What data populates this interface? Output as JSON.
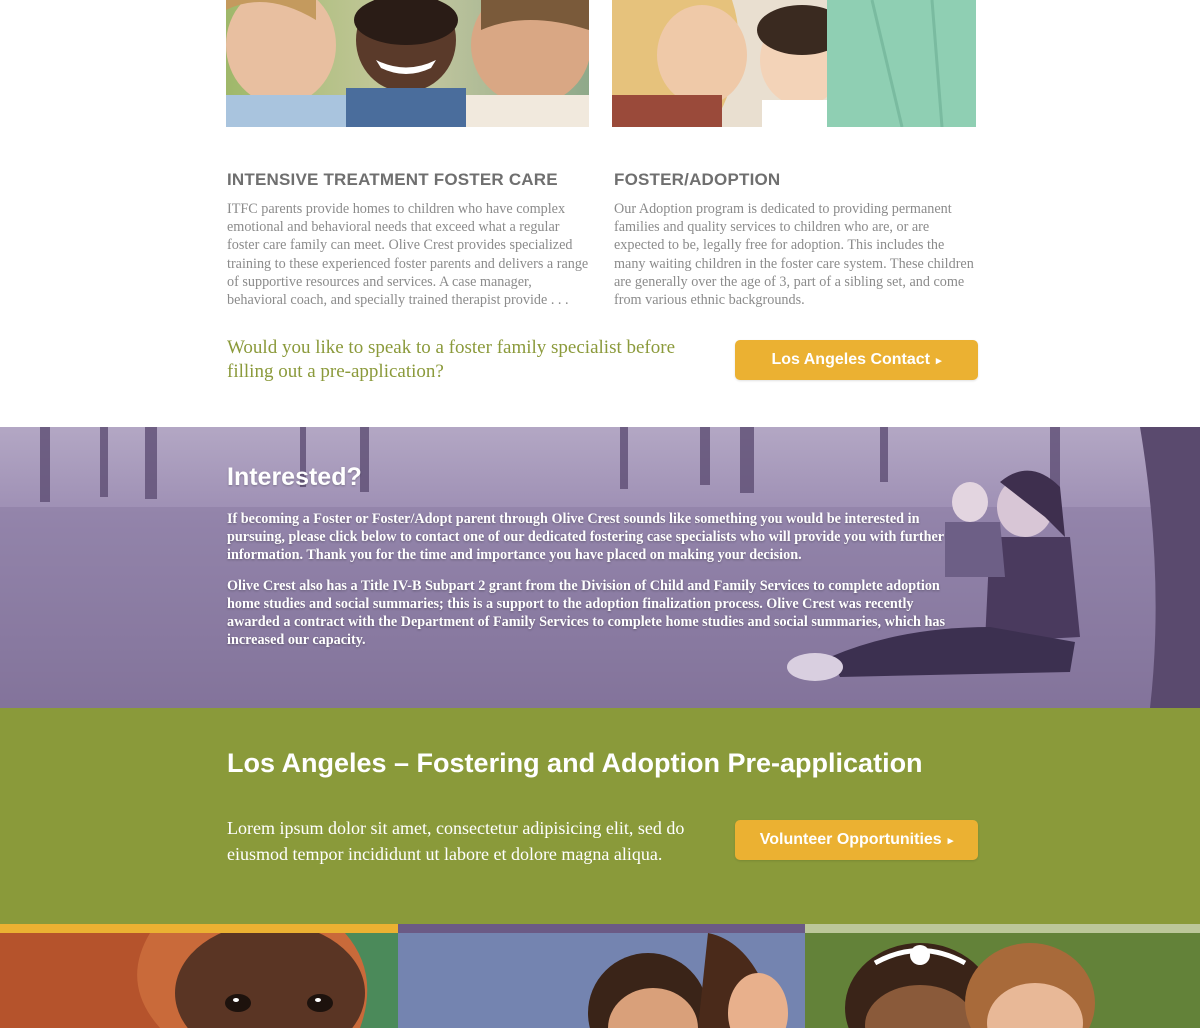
{
  "colors": {
    "accent_yellow": "#ebb132",
    "olive_green": "#8a9a3a",
    "purple": "#8a7aa0",
    "heading_gray": "#6f6f6f",
    "body_gray": "#8b8b8b"
  },
  "programs": [
    {
      "title": "INTENSIVE TREATMENT FOSTER CARE",
      "body": "ITFC parents provide homes to children who have complex emotional and behavioral needs that exceed what a regular foster care family can meet. Olive Crest provides specialized training to these experienced foster parents and delivers a range of supportive resources and services. A case manager, behavioral coach, and specially trained therapist provide . . ."
    },
    {
      "title": "FOSTER/ADOPTION",
      "body": "Our Adoption program is dedicated to providing permanent families and quality services to children who are, or are expected to be, legally free for adoption. This includes the many waiting children in the foster care system. These children are generally over the age of 3, part of a sibling set, and come from various ethnic backgrounds."
    }
  ],
  "cta": {
    "question": "Would you like to speak to a foster family specialist before filling out a pre-application?",
    "button_label": "Los Angeles Contact",
    "button_arrow": "▸"
  },
  "interested": {
    "title": "Interested?",
    "paragraphs": [
      "If becoming a Foster or Foster/Adopt parent through Olive Crest sounds like something you would be interested in pursuing, please click below to contact one of our dedicated fostering case specialists who will provide you with further information. Thank you for the time and importance you have placed on making your decision.",
      "Olive Crest also has a Title IV-B Subpart 2 grant from the Division of Child and Family Services to complete adoption home studies and social summaries; this is a support to the adoption finalization process. Olive Crest was recently awarded a contract with the Department of Family Services to complete home studies and social summaries, which has increased our capacity."
    ]
  },
  "preapp": {
    "title": "Los Angeles – Fostering and Adoption Pre-application",
    "text": "Lorem ipsum dolor sit amet, consectetur adipisicing elit, sed do eiusmod tempor incididunt ut labore et dolore magna aliqua.",
    "button_label": "Volunteer Opportunities",
    "button_arrow": "▸"
  },
  "tiles": [
    {
      "bar_color": "#ebb132"
    },
    {
      "bar_color": "#6b5a85"
    },
    {
      "bar_color": "#bcc79a"
    }
  ]
}
